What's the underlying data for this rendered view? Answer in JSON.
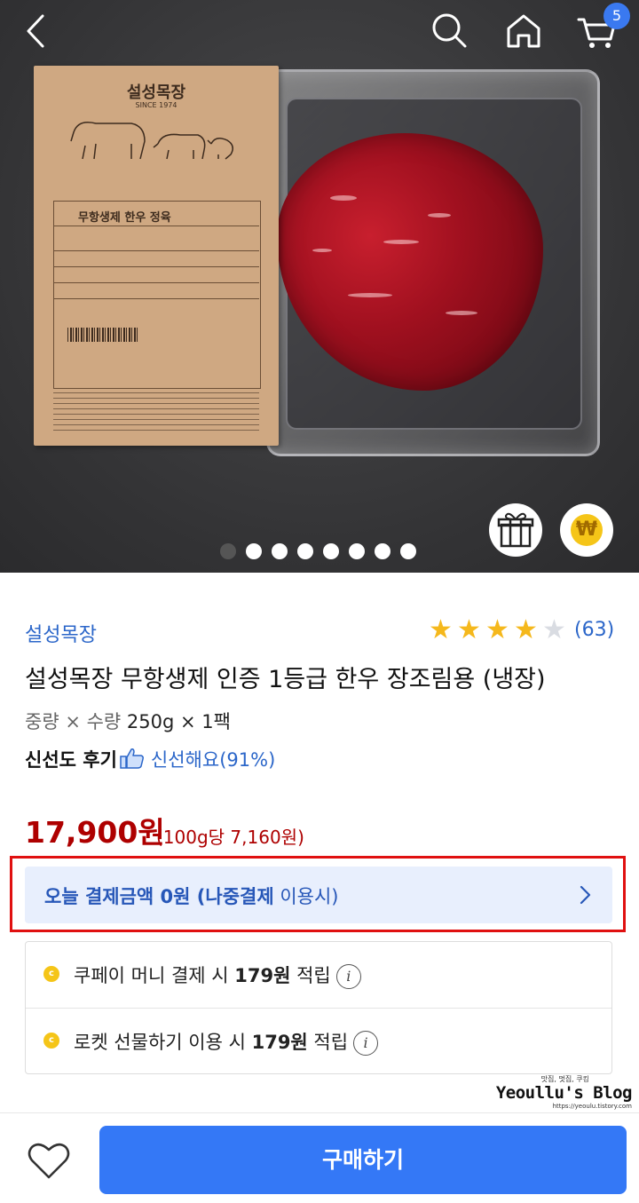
{
  "header": {
    "cart_count": "5"
  },
  "product_image": {
    "label_brand": "설성목장",
    "label_since": "SINCE 1974",
    "label_product": "무항생제 한우 정육",
    "slide_count": 8,
    "active_slide": 0
  },
  "product": {
    "brand": "설성목장",
    "rating": 4,
    "rating_max": 5,
    "review_count": "(63)",
    "title": "설성목장 무항생제 인증 1등급 한우 장조림용 (냉장)",
    "spec_label": "중량 × 수량",
    "spec_value": "250g × 1팩",
    "freshness_label": "신선도 후기",
    "freshness_value": "신선해요(91%)",
    "price": "17,900원",
    "unit_price": "(100g당 7,160원)"
  },
  "pay_later": {
    "bold_text": "오늘 결제금액 0원 (나중결제",
    "normal_text": " 이용시)"
  },
  "points": [
    {
      "prefix": "쿠페이 머니 결제 시 ",
      "amount": "179원",
      "suffix": " 적립"
    },
    {
      "prefix": "로켓 선물하기 이용 시 ",
      "amount": "179원",
      "suffix": " 적립"
    }
  ],
  "watermark": {
    "top": "맛집, 멋집, 쿠킹",
    "main": "Yeoullu's Blog",
    "url": "https://yeoulu.tistory.com"
  },
  "buy_button": "구매하기",
  "colors": {
    "accent_blue": "#3478f6",
    "link_blue": "#2b66c9",
    "price_red": "#ae0000",
    "highlight_red": "#e01010",
    "star_gold": "#f5b81c"
  },
  "icons": {
    "back": "chevron-left-icon",
    "search": "search-icon",
    "home": "home-icon",
    "cart": "cart-icon",
    "gift": "gift-icon",
    "won": "won-coin-icon",
    "heart": "heart-icon",
    "thumbs_up": "thumbs-up-icon",
    "info": "info-icon"
  }
}
